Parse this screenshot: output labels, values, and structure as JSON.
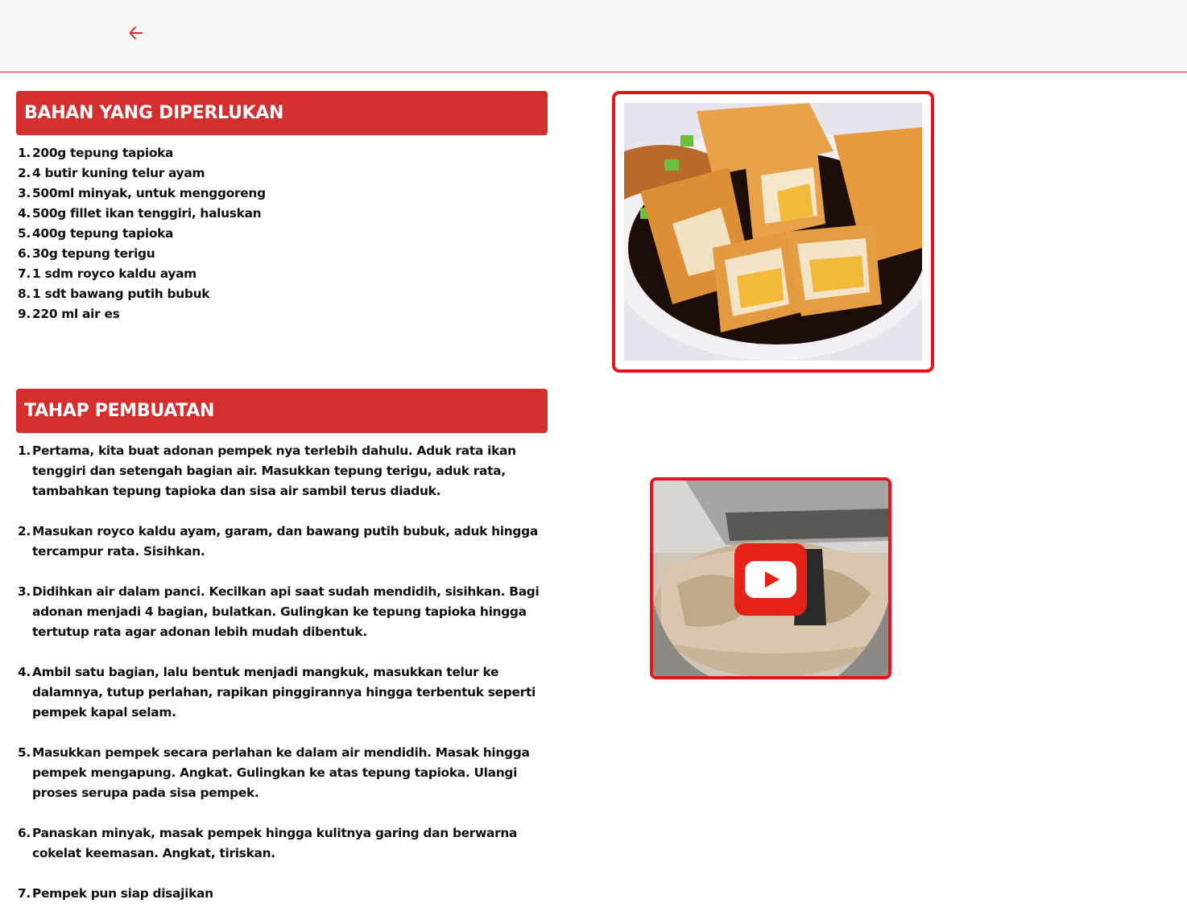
{
  "header": {
    "back_icon": "arrow-left-icon",
    "accent_color": "#d32f2f"
  },
  "bahan": {
    "title": "BAHAN YANG DIPERLUKAN",
    "items": [
      "200g tepung tapioka",
      "4 butir kuning telur ayam",
      "500ml minyak, untuk menggoreng",
      "500g fillet ikan tenggiri, haluskan",
      "400g tepung tapioka",
      "30g tepung terigu",
      "1 sdm royco kaldu ayam",
      "1 sdt bawang putih bubuk",
      "220 ml air es"
    ]
  },
  "tahap": {
    "title": "TAHAP PEMBUATAN",
    "steps": [
      "Pertama, kita buat adonan pempek nya terlebih dahulu. Aduk rata ikan tenggiri dan setengah bagian air. Masukkan tepung terigu, aduk rata, tambahkan tepung tapioka dan sisa air sambil terus diaduk.",
      "Masukan royco kaldu ayam, garam, dan bawang putih bubuk, aduk hingga tercampur rata. Sisihkan.",
      "Didihkan air dalam panci. Kecilkan api saat sudah mendidih, sisihkan. Bagi adonan menjadi 4 bagian, bulatkan. Gulingkan ke tepung tapioka hingga tertutup rata agar adonan lebih mudah dibentuk.",
      "Ambil satu bagian, lalu bentuk menjadi mangkuk, masukkan telur ke dalamnya, tutup perlahan, rapikan pinggirannya hingga terbentuk seperti pempek kapal selam.",
      "Masukkan pempek secara perlahan ke dalam air mendidih. Masak hingga pempek mengapung. Angkat. Gulingkan ke atas tepung tapioka. Ulangi proses serupa pada sisa pempek.",
      "Panaskan minyak, masak pempek hingga kulitnya garing dan berwarna cokelat keemasan. Angkat, tiriskan.",
      "Pempek pun siap disajikan"
    ]
  },
  "media": {
    "photo_icon": "food-photo",
    "video_icon": "youtube-play-icon",
    "frame_color": "#e8141a"
  }
}
